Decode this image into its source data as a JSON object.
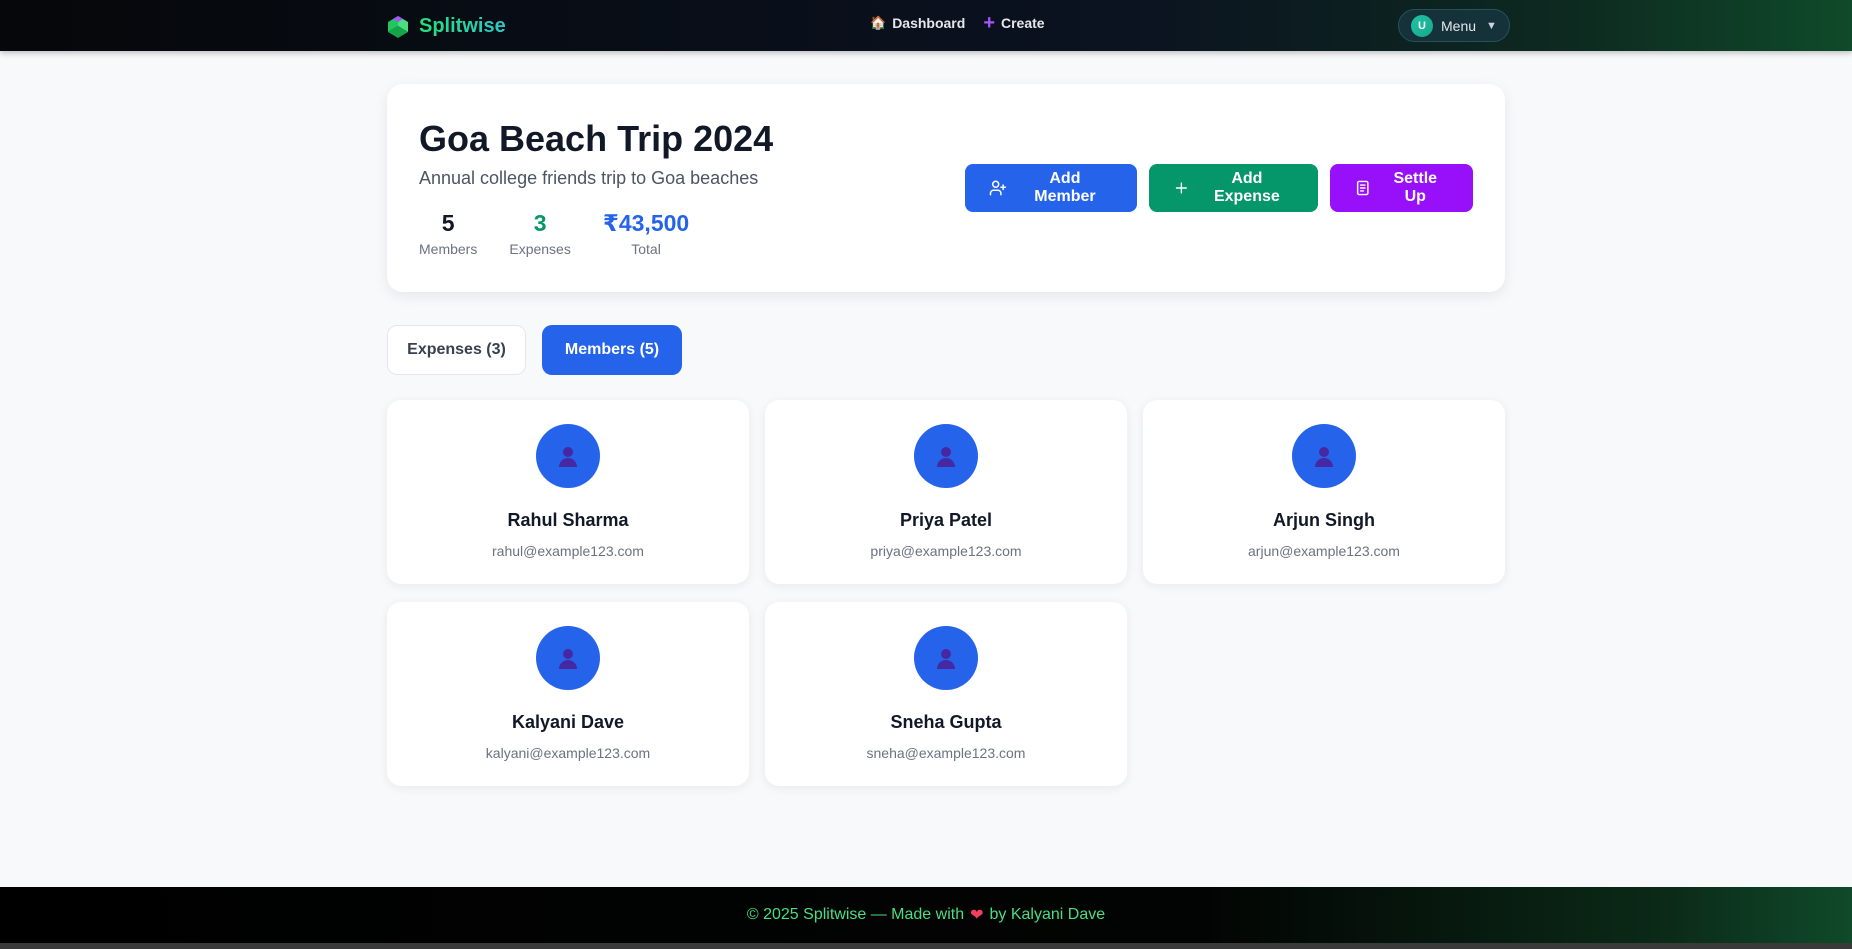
{
  "nav": {
    "brand": "Splitwise",
    "links": [
      {
        "label": "Dashboard",
        "icon": "house-icon"
      },
      {
        "label": "Create",
        "icon": "plus-icon"
      }
    ],
    "menu": {
      "avatar_initial": "U",
      "label": "Menu"
    }
  },
  "group": {
    "title": "Goa Beach Trip 2024",
    "description": "Annual college friends trip to Goa beaches",
    "stats": {
      "members_value": "5",
      "members_label": "Members",
      "expenses_value": "3",
      "expenses_label": "Expenses",
      "total_value": "₹43,500",
      "total_label": "Total"
    },
    "actions": {
      "add_member": "Add Member",
      "add_expense": "Add Expense",
      "settle_up": "Settle Up"
    }
  },
  "tabs": {
    "expenses": "Expenses (3)",
    "members": "Members (5)",
    "active": "members"
  },
  "members": [
    {
      "name": "Rahul Sharma",
      "email": "rahul@example123.com"
    },
    {
      "name": "Priya Patel",
      "email": "priya@example123.com"
    },
    {
      "name": "Arjun Singh",
      "email": "arjun@example123.com"
    },
    {
      "name": "Kalyani Dave",
      "email": "kalyani@example123.com"
    },
    {
      "name": "Sneha Gupta",
      "email": "sneha@example123.com"
    }
  ],
  "footer": {
    "prefix": "© 2025 Splitwise — Made with",
    "suffix": "by Kalyani Dave"
  },
  "colors": {
    "primary": "#2563eb",
    "success": "#059669",
    "purple": "#9810fa",
    "brand_green": "#22e07a"
  }
}
